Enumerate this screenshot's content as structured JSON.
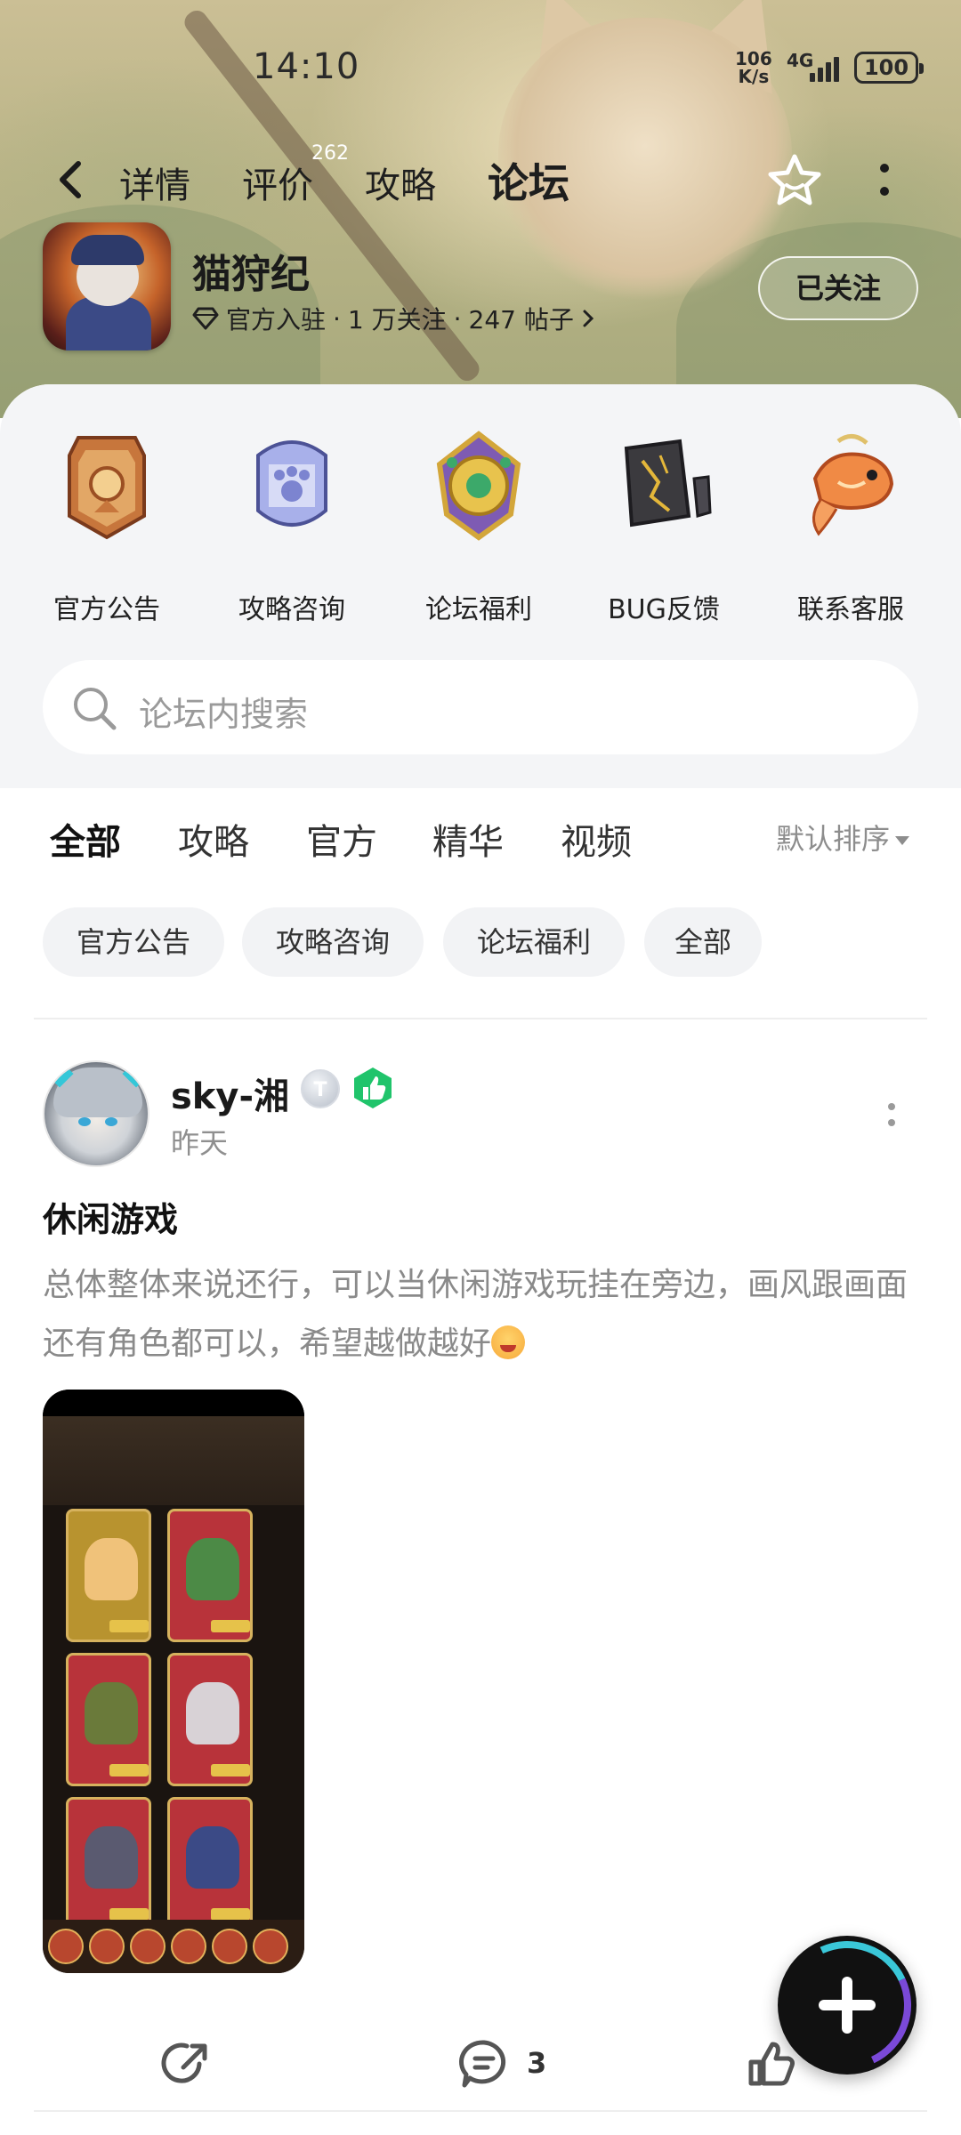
{
  "status_bar": {
    "time": "14:10",
    "net_speed_value": "106",
    "net_speed_unit": "K/s",
    "network": "4G",
    "battery": "100"
  },
  "nav": {
    "tabs": [
      {
        "label": "详情"
      },
      {
        "label": "评价"
      },
      {
        "label": "攻略"
      },
      {
        "label": "论坛"
      }
    ],
    "review_count": "262",
    "active_tab": "论坛"
  },
  "game": {
    "title": "猫狩纪",
    "official": "官方入驻",
    "followers": "1 万关注",
    "posts": "247 帖子",
    "follow_button": "已关注"
  },
  "quick_links": [
    {
      "label": "官方公告",
      "icon": "announcement-icon"
    },
    {
      "label": "攻略咨询",
      "icon": "guide-icon"
    },
    {
      "label": "论坛福利",
      "icon": "welfare-icon"
    },
    {
      "label": "BUG反馈",
      "icon": "bug-feedback-icon"
    },
    {
      "label": "联系客服",
      "icon": "customer-service-icon"
    }
  ],
  "search": {
    "placeholder": "论坛内搜索"
  },
  "filter_tabs": [
    {
      "label": "全部"
    },
    {
      "label": "攻略"
    },
    {
      "label": "官方"
    },
    {
      "label": "精华"
    },
    {
      "label": "视频"
    }
  ],
  "sort_label": "默认排序",
  "chips": [
    {
      "label": "官方公告"
    },
    {
      "label": "攻略咨询"
    },
    {
      "label": "论坛福利"
    },
    {
      "label": "全部"
    }
  ],
  "post": {
    "username": "sky-湘",
    "level_badge": "T",
    "time": "昨天",
    "title": "休闲游戏",
    "body": "总体整体来说还行，可以当休闲游戏玩挂在旁边，画风跟画面还有角色都可以，希望越做越好",
    "comment_count": "3"
  },
  "colors": {
    "accent": "#22d8c4",
    "text_primary": "#1a1a1a",
    "text_secondary": "#8a8a8a"
  }
}
